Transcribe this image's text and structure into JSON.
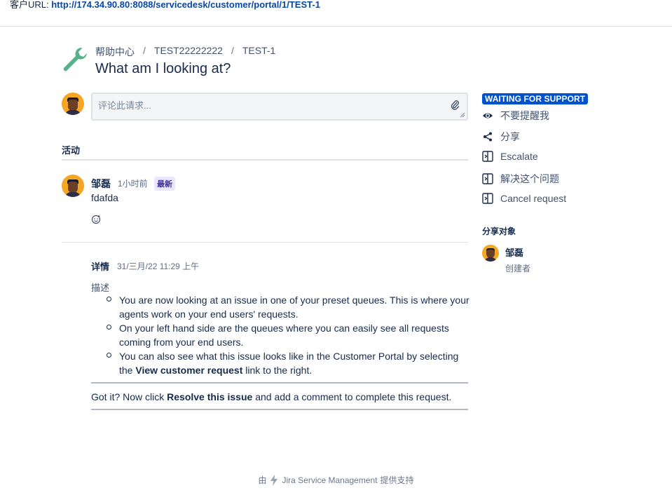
{
  "topbar": {
    "label": "客户URL: ",
    "url": "http://174.34.90.80:8088/servicedesk/customer/portal/1/TEST-1"
  },
  "header": {
    "icon": "wrench-icon",
    "breadcrumb": [
      "帮助中心",
      "TEST22222222",
      "TEST-1"
    ],
    "separator": "/",
    "title": "What am I looking at?"
  },
  "comment_box": {
    "placeholder": "评论此请求..."
  },
  "activity": {
    "heading": "活动",
    "comment": {
      "author": "邹磊",
      "time": "1小时前",
      "badge": "最新",
      "text": "fdafda"
    }
  },
  "details": {
    "label": "详情",
    "time": "31/三月/22 11:29 上午",
    "desc_label": "描述",
    "items": [
      {
        "text": "You are now looking at an issue in one of your preset queues. This is where your agents work on your end users' requests."
      },
      {
        "text": "On your left hand side are the queues where you can easily see all requests coming from your end users."
      },
      {
        "pre": "You can also see what this issue looks like in the Customer Portal by selecting the ",
        "bold": "View customer request",
        "post": " link to the right."
      }
    ],
    "footer_pre": "Got it? Now click ",
    "footer_bold": "Resolve this issue",
    "footer_post": " and add a comment to complete this request."
  },
  "sidebar": {
    "status": "WAITING FOR SUPPORT",
    "status_color": "#0052cc",
    "actions": [
      {
        "label": "不要提醒我",
        "icon": "eye-icon"
      },
      {
        "label": "分享",
        "icon": "share-icon"
      },
      {
        "label": "Escalate",
        "icon": "transition-icon"
      },
      {
        "label": "解决这个问题",
        "icon": "transition-icon"
      },
      {
        "label": "Cancel request",
        "icon": "transition-icon"
      }
    ],
    "share_heading": "分享对象",
    "share_name": "邹磊",
    "share_role": "创建者"
  },
  "footer": {
    "pre": "由",
    "product": "Jira Service Management",
    "post": "提供支持"
  }
}
